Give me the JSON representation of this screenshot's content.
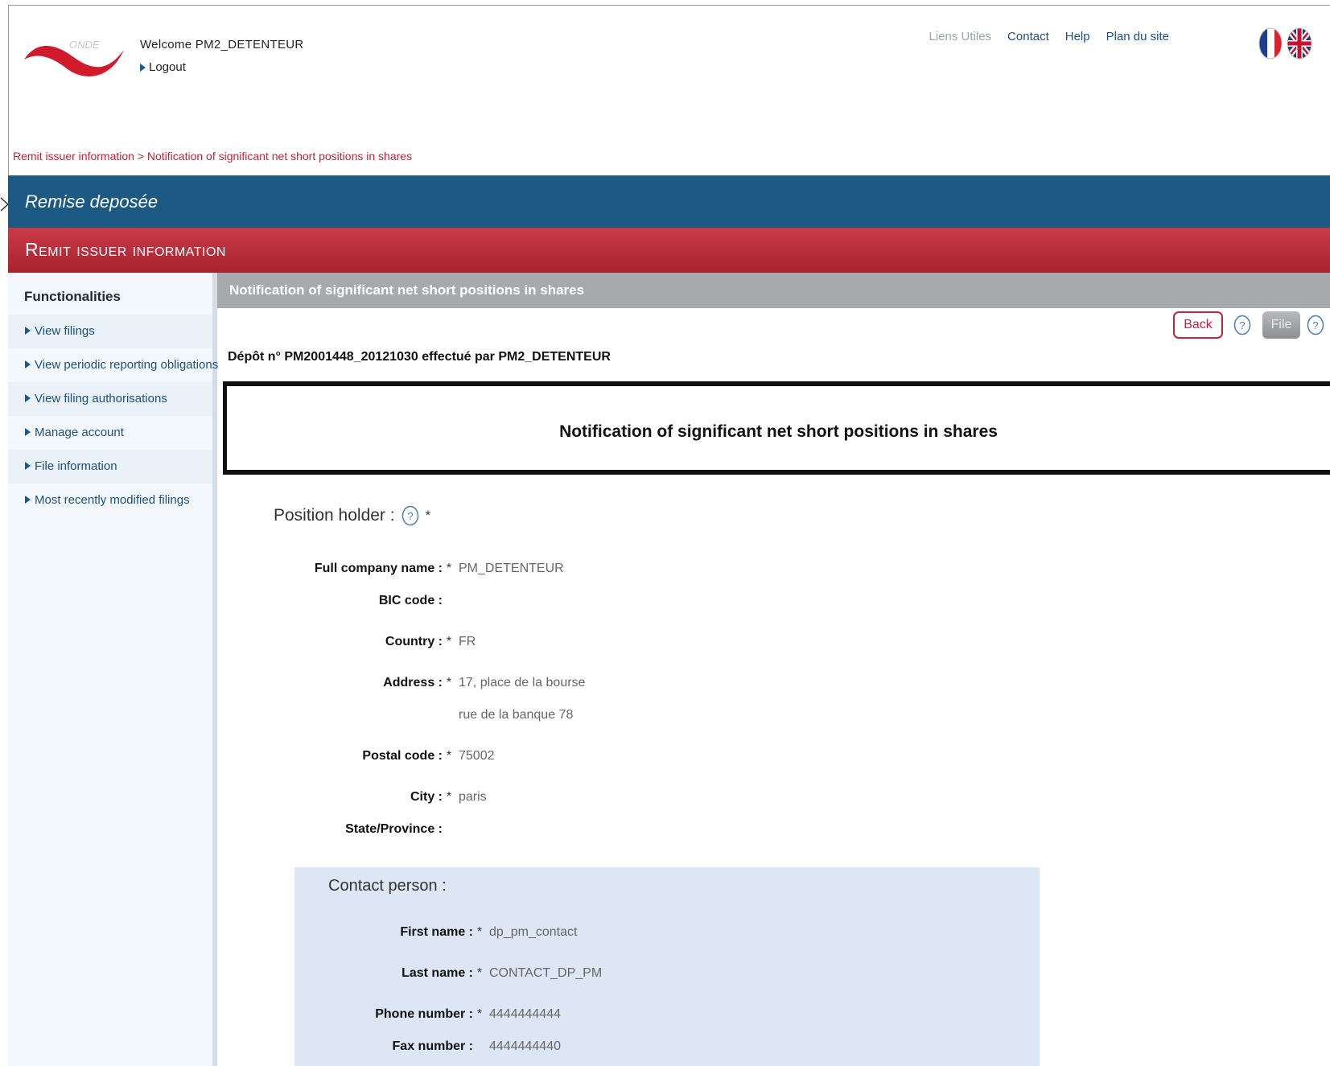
{
  "header": {
    "welcome": "Welcome PM2_DETENTEUR",
    "logout": "Logout",
    "logo_text": "ONDE",
    "links": [
      {
        "label": "Liens Utiles",
        "muted": true
      },
      {
        "label": "Contact",
        "muted": false
      },
      {
        "label": "Help",
        "muted": false
      },
      {
        "label": "Plan du site",
        "muted": false
      }
    ]
  },
  "breadcrumb": "Remit issuer information > Notification of significant net short positions in shares",
  "banner": {
    "status": "Remise deposée",
    "section": "Remit issuer information"
  },
  "sidebar": {
    "title": "Functionalities",
    "items": [
      "View filings",
      "View periodic reporting obligations",
      "View filing authorisations",
      "Manage account",
      "File information",
      "Most recently modified filings"
    ]
  },
  "main": {
    "header": "Notification of significant net short positions in shares",
    "back_label": "Back",
    "file_label": "File",
    "deposit_line": "Dépôt n° PM2001448_20121030 effectué par PM2_DETENTEUR",
    "form_title": "Notification of significant net short positions in shares",
    "position_holder": {
      "title": "Position holder :",
      "fields": [
        {
          "label": "Full company name :",
          "required": true,
          "value": "PM_DETENTEUR"
        },
        {
          "label": "BIC code :",
          "required": false,
          "value": ""
        },
        {
          "label": "Country :",
          "required": true,
          "value": "FR"
        },
        {
          "label": "Address :",
          "required": true,
          "value": "17, place de la bourse"
        },
        {
          "label": "",
          "required": false,
          "value": "rue de la banque 78"
        },
        {
          "label": "Postal code :",
          "required": true,
          "value": "75002"
        },
        {
          "label": "City :",
          "required": true,
          "value": "paris"
        },
        {
          "label": "State/Province :",
          "required": false,
          "value": ""
        }
      ]
    },
    "contact_person": {
      "title": "Contact person :",
      "fields": [
        {
          "label": "First name :",
          "required": true,
          "value": "dp_pm_contact"
        },
        {
          "label": "Last name :",
          "required": true,
          "value": "CONTACT_DP_PM"
        },
        {
          "label": "Phone number :",
          "required": true,
          "value": "4444444444"
        },
        {
          "label": "Fax number :",
          "required": false,
          "value": "4444444440"
        }
      ]
    }
  },
  "colors": {
    "blue_banner": "#1c5a84",
    "red_banner": "#b52c38",
    "link": "#1f4f7f",
    "breadcrumb": "#c0243a"
  }
}
